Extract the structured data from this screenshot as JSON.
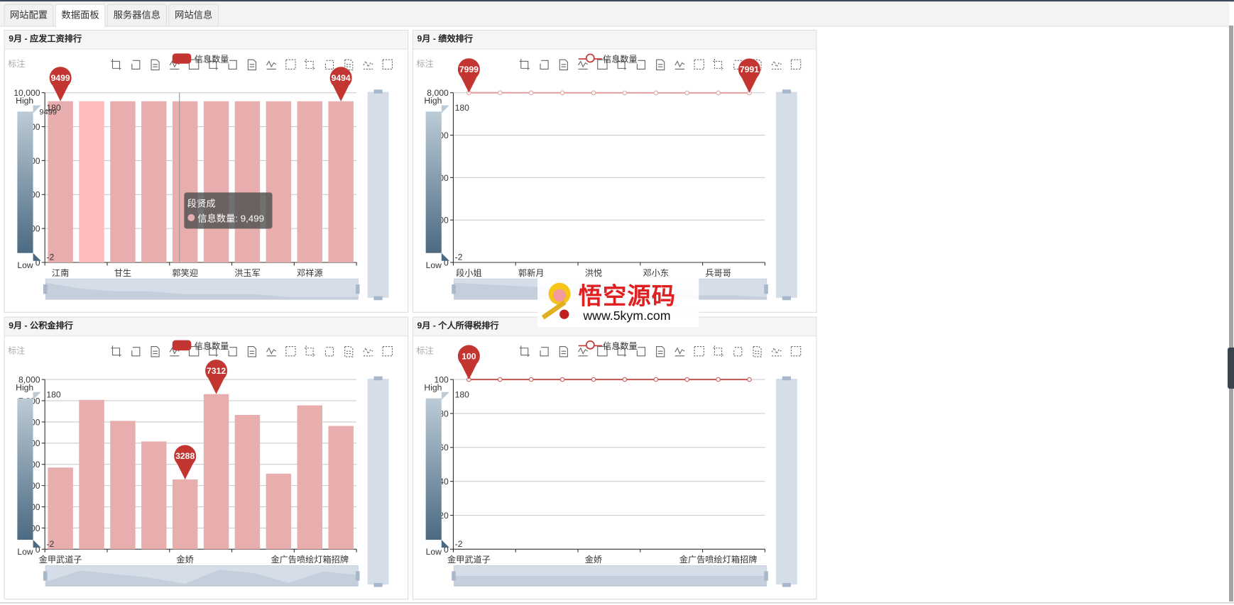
{
  "tabs": [
    {
      "label": "网站配置",
      "active": false
    },
    {
      "label": "数据面板",
      "active": true
    },
    {
      "label": "服务器信息",
      "active": false
    },
    {
      "label": "网站信息",
      "active": false
    }
  ],
  "watermark": {
    "title": "悟空源码",
    "url": "www.5kym.com"
  },
  "common": {
    "legend_label": "信息数量",
    "mark_label": "标注",
    "visualmap_high": "High",
    "visualmap_low": "Low",
    "visualmap_max": "180",
    "visualmap_min": "-2",
    "toolbox_icons": [
      "crop-icon",
      "undo-icon",
      "data-view-icon",
      "line-chart-icon",
      "bar-chart-icon",
      "stack-icon",
      "tiled-icon",
      "restore-icon",
      "save-image-icon",
      "rect-select-icon",
      "polygon-select-icon",
      "keep-select-icon",
      "clear-select-icon",
      "zoom-icon",
      "zoom-reset-icon"
    ]
  },
  "colors": {
    "bar": "#e8adad",
    "bar_highlight": "#ffbcbc",
    "marker": "#c23531",
    "line": "#e3a5a5",
    "line_dark": "#c8605a",
    "visualmap_top": "#bccbd6",
    "visualmap_bottom": "#4b6a82",
    "slider": "#d5dde8"
  },
  "chart_data": [
    {
      "title": "9月 - 应发工资排行",
      "type": "bar",
      "series_name": "信息数量",
      "categories": [
        "江南",
        "",
        "甘生",
        "",
        "郭笑迎",
        "",
        "洪玉军",
        "",
        "邓祥源",
        ""
      ],
      "values": [
        9499,
        9497,
        9496,
        9496,
        9495,
        9495,
        9495,
        9494,
        9494,
        9494
      ],
      "ylim": [
        0,
        10000
      ],
      "ytick_step": 2000,
      "highlight_index": 1,
      "mark_points": [
        {
          "index": 0,
          "value": 9499,
          "label": "9499"
        },
        {
          "index": 9,
          "value": 9494,
          "label": "9494"
        }
      ],
      "tooltip": {
        "title": "段贤成",
        "text": "信息数量: 9,499",
        "index": 4
      },
      "visualmap_value_label": "9499"
    },
    {
      "title": "9月 - 绩效排行",
      "type": "line",
      "series_name": "信息数量",
      "categories": [
        "段小姐",
        "",
        "郭新月",
        "",
        "洪悦",
        "",
        "邓小东",
        "",
        "兵哥哥",
        ""
      ],
      "values": [
        7999,
        7998,
        7997,
        7996,
        7995,
        7994,
        7993,
        7992,
        7992,
        7991
      ],
      "ylim": [
        0,
        8000
      ],
      "ytick_step": 2000,
      "mark_points": [
        {
          "index": 0,
          "value": 7999,
          "label": "7999"
        },
        {
          "index": 9,
          "value": 7991,
          "label": "7991"
        }
      ]
    },
    {
      "title": "9月 - 公积金排行",
      "type": "bar",
      "series_name": "信息数量",
      "categories": [
        "金甲武道子",
        "",
        "",
        "",
        "金娇",
        "",
        "",
        "",
        "金广告喷绘灯箱招牌",
        ""
      ],
      "values": [
        3850,
        7040,
        6050,
        5080,
        3288,
        7312,
        6330,
        3560,
        6780,
        5810
      ],
      "ylim": [
        0,
        8000
      ],
      "ytick_step": 1000,
      "mark_points": [
        {
          "index": 5,
          "value": 7312,
          "label": "7312"
        },
        {
          "index": 4,
          "value": 3288,
          "label": "3288"
        }
      ]
    },
    {
      "title": "9月 - 个人所得税排行",
      "type": "line",
      "dark": true,
      "series_name": "信息数量",
      "categories": [
        "金甲武道子",
        "",
        "",
        "",
        "金娇",
        "",
        "",
        "",
        "金广告喷绘灯箱招牌",
        ""
      ],
      "values": [
        100,
        100,
        100,
        100,
        100,
        100,
        100,
        100,
        100,
        100
      ],
      "ylim": [
        0,
        100
      ],
      "ytick_step": 20,
      "mark_points": [
        {
          "index": 0,
          "value": 100,
          "label": "100"
        }
      ]
    }
  ]
}
